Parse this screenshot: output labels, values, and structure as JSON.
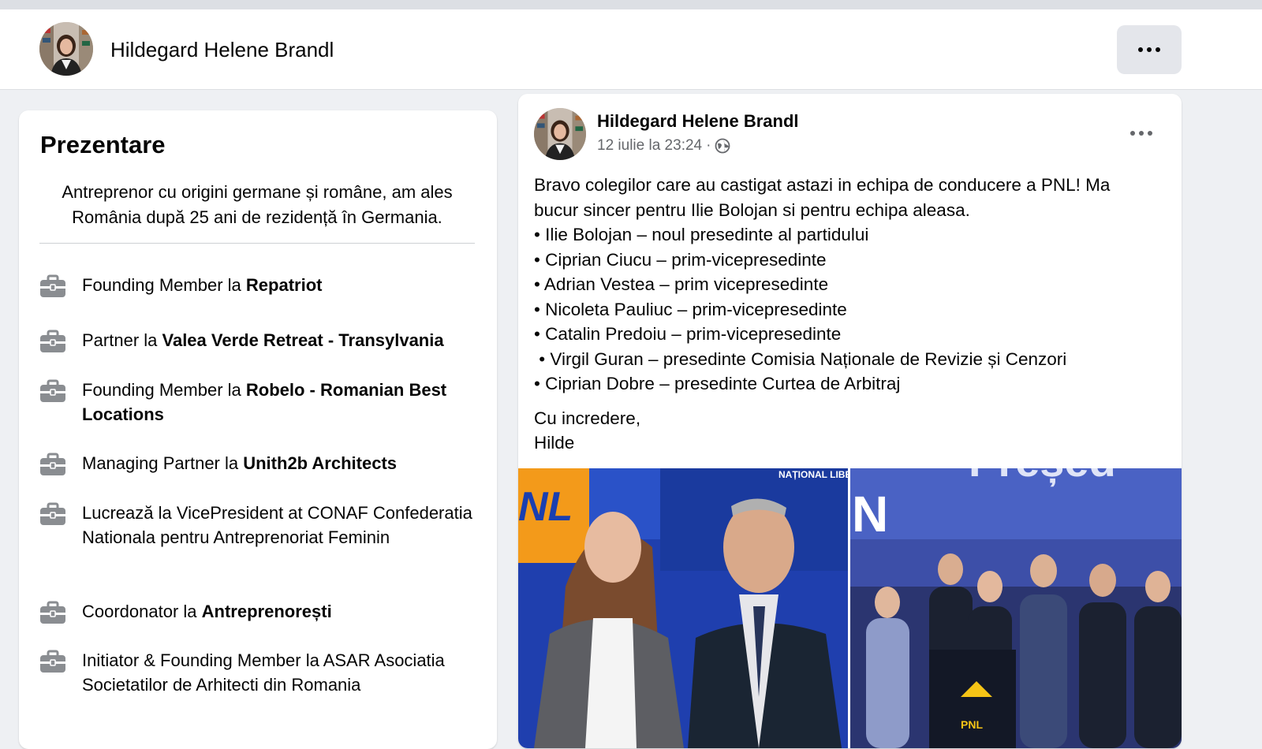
{
  "header": {
    "profile_name": "Hildegard Helene Brandl",
    "more_icon": "more-horizontal-icon"
  },
  "intro": {
    "title": "Prezentare",
    "bio": "Antreprenor cu origini germane și române, am ales România după 25 ani de rezidență în Germania.",
    "work_icon": "briefcase-icon",
    "items": [
      {
        "prefix": "Founding Member la ",
        "org": "Repatriot",
        "suffix": ""
      },
      {
        "prefix": "Partner la ",
        "org": "Valea Verde Retreat - Transylvania",
        "suffix": ""
      },
      {
        "prefix": "Founding Member la ",
        "org": "Robelo - Romanian Best Locations",
        "suffix": ""
      },
      {
        "prefix": "Managing Partner la ",
        "org": "Unith2b Architects",
        "suffix": ""
      },
      {
        "prefix": "",
        "org": "",
        "suffix": "Lucrează la VicePresident at CONAF Confederatia Nationala pentru Antreprenoriat Feminin"
      },
      {
        "prefix": "Coordonator la ",
        "org": "Antreprenorești",
        "suffix": ""
      },
      {
        "prefix": "",
        "org": "",
        "suffix": "Initiator & Founding Member la ASAR Asociatia Societatilor de Arhitecti din Romania"
      }
    ]
  },
  "post": {
    "author": "Hildegard Helene Brandl",
    "timestamp": "12 iulie la 23:24",
    "separator": "·",
    "audience_icon": "globe-icon",
    "lines": [
      "Bravo colegilor care au castigat astazi in echipa de conducere a PNL! Ma bucur sincer pentru Ilie Bolojan si pentru echipa aleasa.",
      "• Ilie Bolojan – noul presedinte al partidului",
      "• Ciprian Ciucu – prim-vicepresedinte",
      "• Adrian Vestea – prim vicepresedinte",
      "• Nicoleta Pauliuc – prim-vicepresedinte",
      "• Catalin Predoiu – prim-vicepresedinte",
      " • Virgil Guran – presedinte Comisia Naționale de Revizie și Cenzori",
      "• Ciprian Dobre – presedinte Curtea de Arbitraj"
    ],
    "closing": [
      "Cu incredere,",
      "Hilde"
    ],
    "photo_left_banner": "NL",
    "photo_left_banner_small": "NAȚIONAL LIBERAL",
    "photo_right_banner": "Președ",
    "photo_right_letter": "N",
    "photo_right_podium": "PNL"
  },
  "colors": {
    "pnl_blue": "#1a3fb0",
    "pnl_yellow": "#f6c416",
    "stage_blue": "#3d4fa8"
  }
}
